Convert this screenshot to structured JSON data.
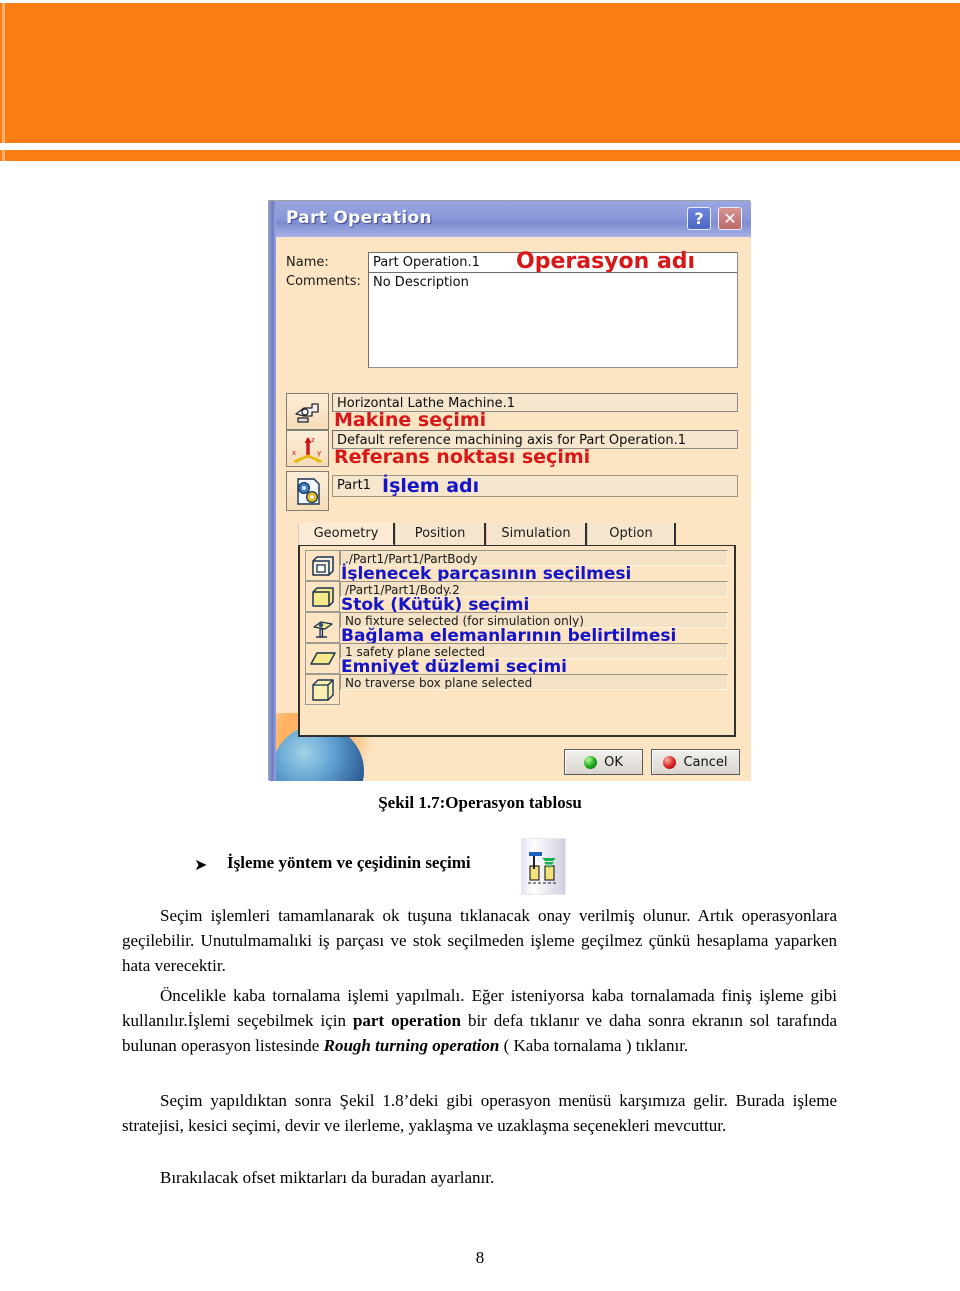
{
  "banner": {
    "accent_color": "#f97d13",
    "light_accent_color": "#fcb272"
  },
  "dialog": {
    "title": "Part Operation",
    "help_button_label": "?",
    "close_button_label": "✕",
    "name_label": "Name:",
    "comments_label": "Comments:",
    "name_value": "Part Operation.1",
    "comments_value": "No Description",
    "machine_value": "Horizontal Lathe Machine.1",
    "axis_value": "Default reference machining axis for Part Operation.1",
    "part_value": "Part1",
    "tabs": [
      {
        "label": "Geometry",
        "selected": true
      },
      {
        "label": "Position",
        "selected": false
      },
      {
        "label": "Simulation",
        "selected": false
      },
      {
        "label": "Option",
        "selected": false
      }
    ],
    "geometry_rows": [
      {
        "icon": "part-body-icon",
        "value": "./Part1/Part1/PartBody"
      },
      {
        "icon": "stock-cube-icon",
        "value": "/Part1/Part1/Body.2"
      },
      {
        "icon": "fixture-clamp-icon",
        "value": "No fixture selected (for simulation only)"
      },
      {
        "icon": "safety-plane-icon",
        "value": "1 safety plane selected"
      },
      {
        "icon": "traverse-box-icon",
        "value": "No traverse box plane selected"
      }
    ],
    "ok_label": "OK",
    "cancel_label": "Cancel",
    "annotations": [
      {
        "text": "Operasyon adı",
        "color": "#d81818"
      },
      {
        "text": "Makine seçimi",
        "color": "#d81818"
      },
      {
        "text": "Referans noktası seçimi",
        "color": "#d81818"
      },
      {
        "text": "İşlem adı",
        "color": "#1414c8"
      },
      {
        "text": "İşlenecek parçasının seçilmesi",
        "color": "#1414c8"
      },
      {
        "text": "Stok (Kütük) seçimi",
        "color": "#1414c8"
      },
      {
        "text": "Bağlama elemanlarının belirtilmesi",
        "color": "#1414c8"
      },
      {
        "text": "Emniyet düzlemi seçimi",
        "color": "#1414c8"
      }
    ]
  },
  "document": {
    "figure_caption": "Şekil 1.7:Operasyon tablosu",
    "bullet_glyph": "➤",
    "bullet_text": "İşleme yöntem ve çeşidinin seçimi",
    "paragraph_1_a": "Seçim işlemleri tamamlanarak ok tuşuna tıklanacak onay verilmiş olunur. Artık operasyonlara geçilebilir. Unutulmamalıki iş parçası ve stok seçilmeden işleme geçilmez çünkü hesaplama yaparken hata verecektir.",
    "paragraph_2_a": "Öncelikle kaba tornalama işlemi yapılmalı. Eğer isteniyorsa kaba tornalamada finiş işleme gibi kullanılır.İşlemi seçebilmek için ",
    "paragraph_2_bold": "part operation",
    "paragraph_2_b": " bir defa tıklanır ve daha sonra ekranın sol tarafında bulunan operasyon listesinde ",
    "paragraph_2_italic": "Rough turning operation",
    "paragraph_2_c": "    ( Kaba tornalama ) tıklanır.",
    "paragraph_3": "Seçim yapıldıktan sonra Şekil 1.8’deki gibi operasyon menüsü karşımıza gelir. Burada işleme stratejisi, kesici seçimi, devir ve ilerleme, yaklaşma ve uzaklaşma seçenekleri mevcuttur.",
    "paragraph_4": "Bırakılacak ofset miktarları da buradan ayarlanır.",
    "page_number": "8"
  }
}
